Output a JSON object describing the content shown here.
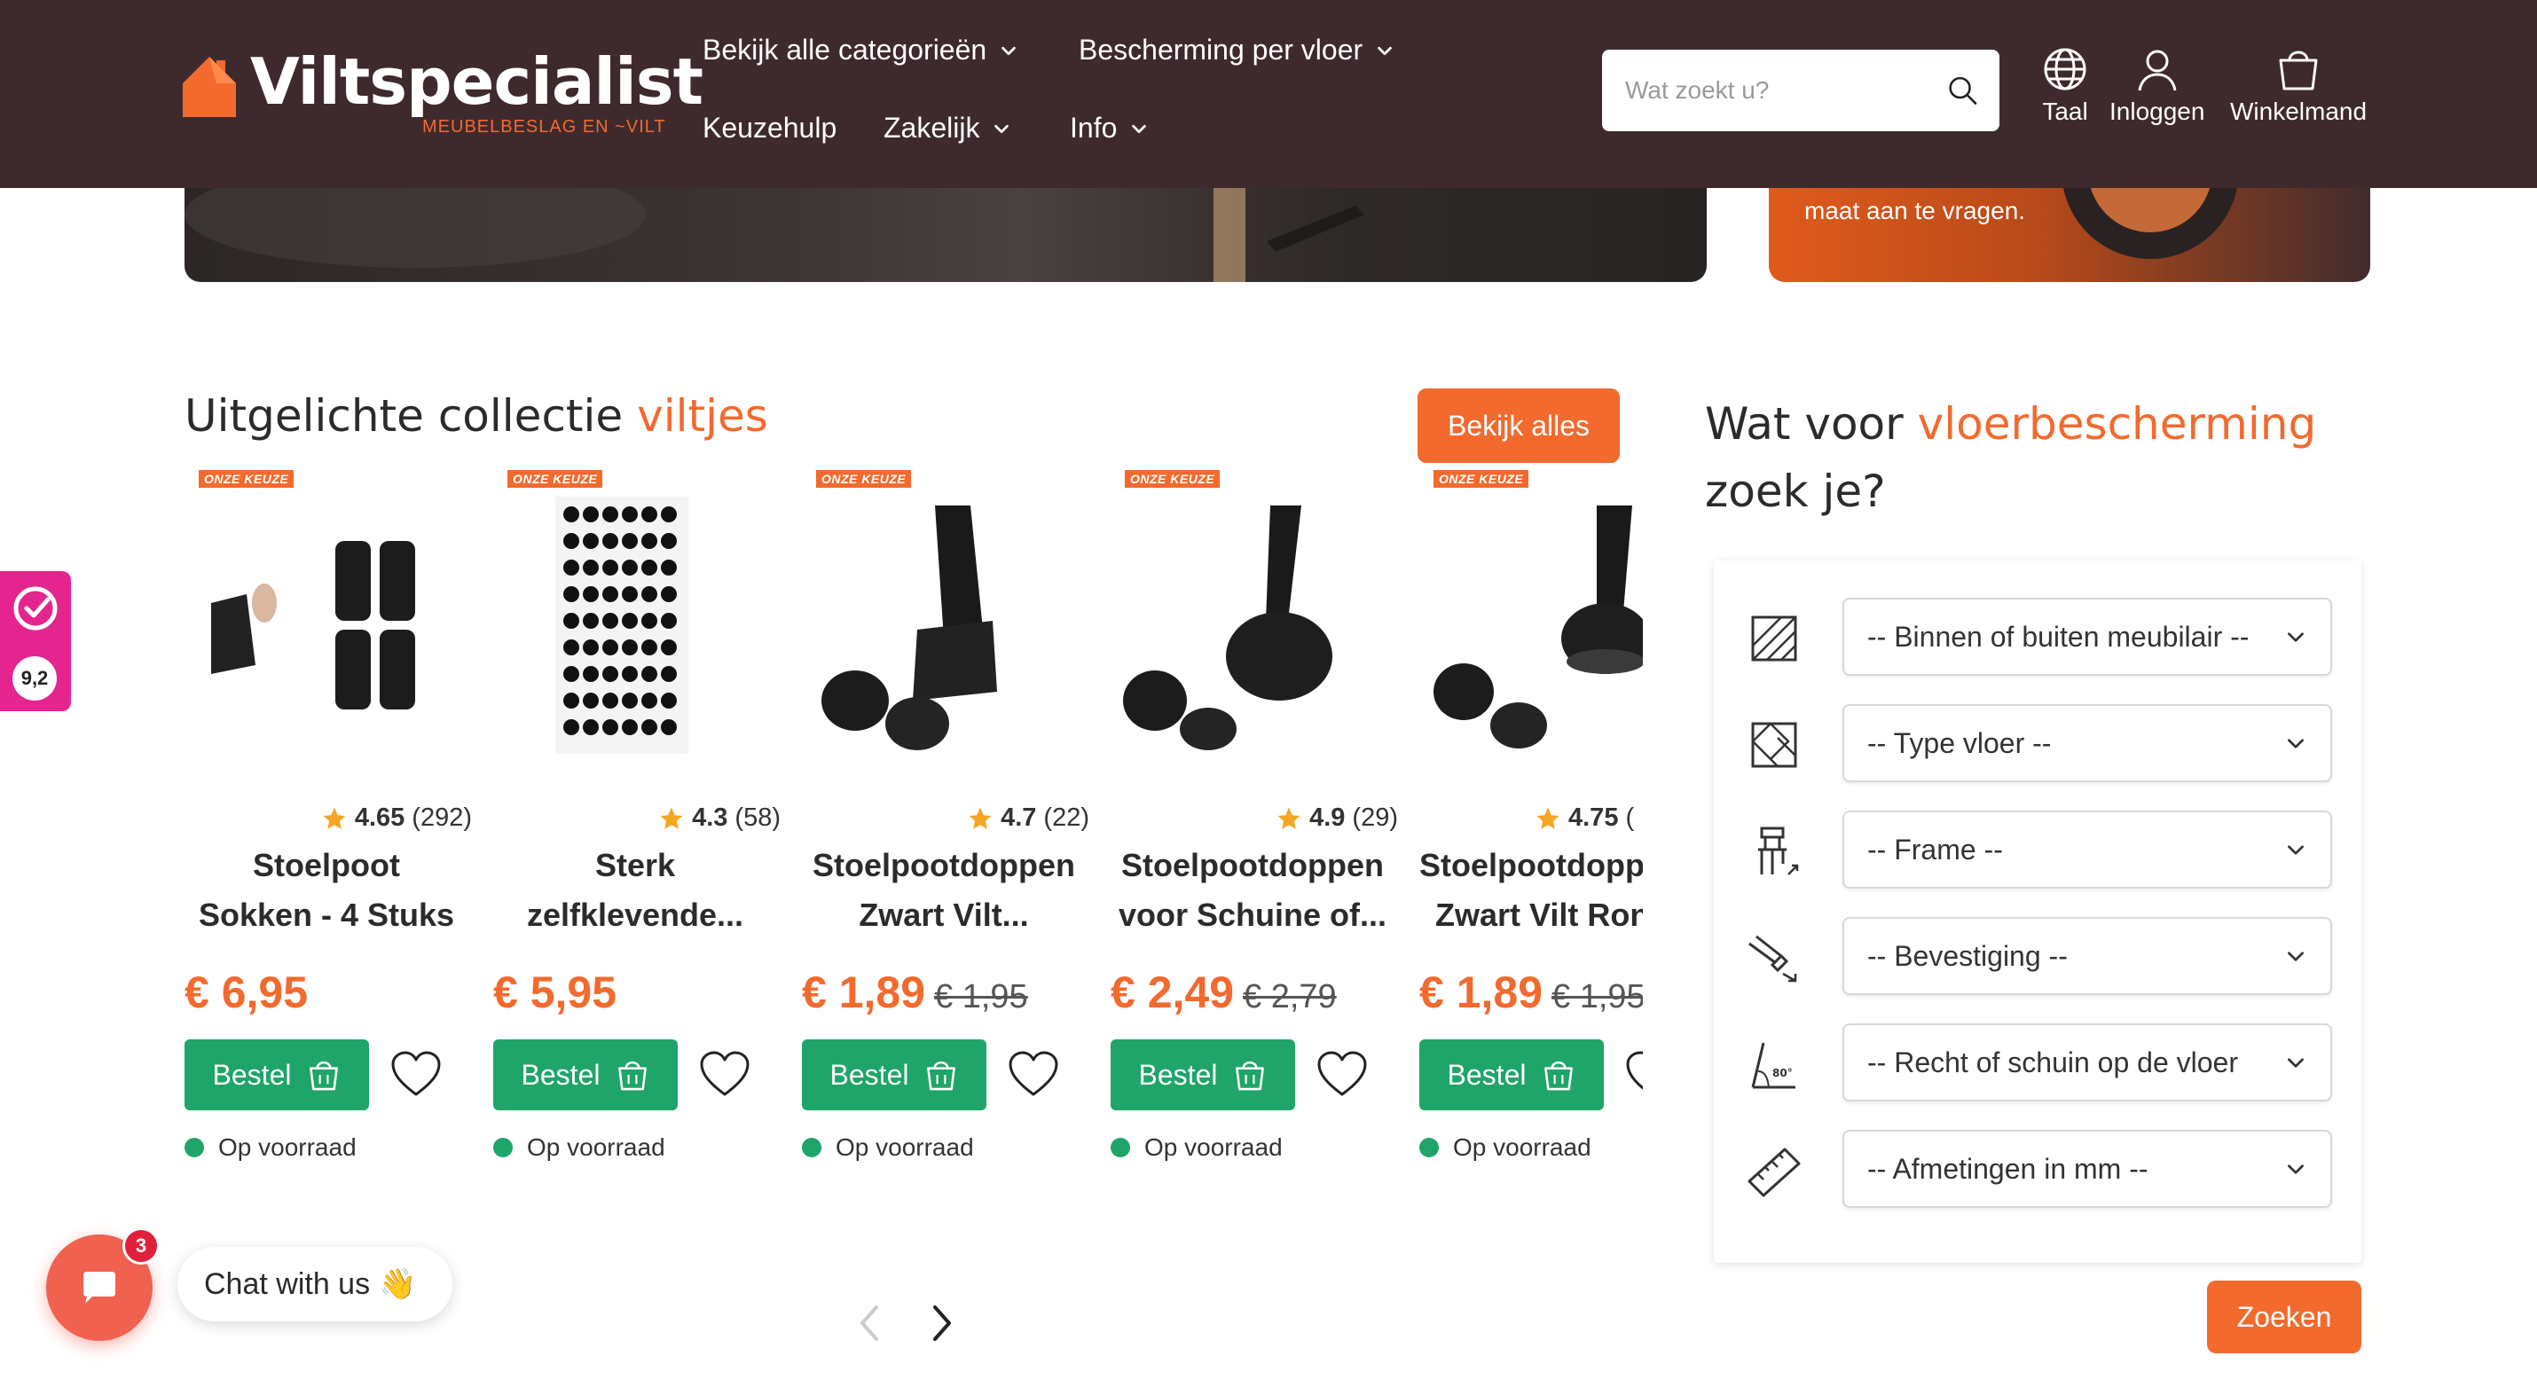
{
  "header": {
    "logo_name": "Viltspecialist",
    "logo_tagline": "MEUBELBESLAG EN ~VILT",
    "nav": [
      {
        "label": "Bekijk alle categorieën"
      },
      {
        "label": "Bescherming per vloer"
      },
      {
        "label": "Keuzehulp"
      },
      {
        "label": "Zakelijk"
      },
      {
        "label": "Info"
      }
    ],
    "search_placeholder": "Wat zoekt u?",
    "language_label": "Taal",
    "login_label": "Inloggen",
    "cart_label": "Winkelmand"
  },
  "banner": {
    "right_text": "maat aan te vragen."
  },
  "collection": {
    "title_prefix": "Uitgelichte collectie",
    "title_accent": "viltjes",
    "view_all_label": "Bekijk alles",
    "badge_label": "ONZE KEUZE",
    "products": [
      {
        "rating": "4.65",
        "reviews": "(292)",
        "title_line1": "Stoelpoot",
        "title_line2": "Sokken - 4 Stuks",
        "price": "€ 6,95",
        "old_price": "",
        "buy_label": "Bestel",
        "stock": "Op voorraad"
      },
      {
        "rating": "4.3",
        "reviews": "(58)",
        "title_line1": "Sterk",
        "title_line2": "zelfklevende...",
        "price": "€ 5,95",
        "old_price": "",
        "buy_label": "Bestel",
        "stock": "Op voorraad"
      },
      {
        "rating": "4.7",
        "reviews": "(22)",
        "title_line1": "Stoelpootdoppen",
        "title_line2": "Zwart Vilt...",
        "price": "€ 1,89",
        "old_price": "€ 1,95",
        "buy_label": "Bestel",
        "stock": "Op voorraad"
      },
      {
        "rating": "4.9",
        "reviews": "(29)",
        "title_line1": "Stoelpootdoppen",
        "title_line2": "voor Schuine of...",
        "price": "€ 2,49",
        "old_price": "€ 2,79",
        "buy_label": "Bestel",
        "stock": "Op voorraad"
      },
      {
        "rating": "4.75",
        "reviews": "(",
        "title_line1": "Stoelpootdopp",
        "title_line2": "Zwart Vilt Ron",
        "price": "€ 1,89",
        "old_price": "€ 1,95",
        "buy_label": "Bestel",
        "stock": "Op voorraad"
      }
    ]
  },
  "finder": {
    "title_prefix": "Wat voor",
    "title_accent": "vloerbescherming",
    "title_suffix": "zoek je?",
    "filters": [
      {
        "label": "-- Binnen of buiten meubilair --",
        "icon": "floor-area-icon"
      },
      {
        "label": "-- Type vloer --",
        "icon": "floor-pattern-icon"
      },
      {
        "label": "-- Frame --",
        "icon": "chair-frame-icon"
      },
      {
        "label": "-- Bevestiging --",
        "icon": "mounting-icon"
      },
      {
        "label": "-- Recht of schuin op de vloer",
        "icon": "angle-icon"
      },
      {
        "label": "-- Afmetingen in mm --",
        "icon": "ruler-icon"
      }
    ],
    "angle_icon_text": "80°",
    "submit_label": "Zoeken"
  },
  "side_widget": {
    "score": "9,2"
  },
  "chat": {
    "label": "Chat with us",
    "emoji": "👋",
    "unread": "3"
  },
  "colors": {
    "header_bg": "#3e2a2d",
    "accent": "#f26a2e",
    "buy_green": "#1fa56a",
    "side_widget": "#e5258f",
    "chat": "#f0614f"
  }
}
